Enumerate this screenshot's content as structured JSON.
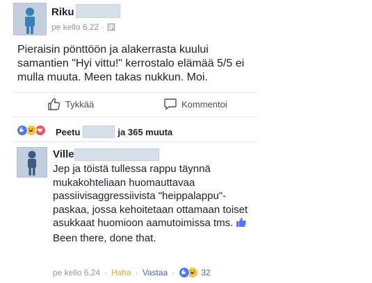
{
  "post": {
    "author": "Riku",
    "time": "pe kello 6.22",
    "separator": "·",
    "text": "Pieraisin pönttöön ja alakerrasta kuului samantien \"Hyi vittu!\" kerrostalo elämää 5/5 ei mulla muuta. Meen takas nukkun. Moi.",
    "privacy_icon": "building-icon"
  },
  "actions": {
    "like_label": "Tykkää",
    "comment_label": "Kommentoi"
  },
  "reactions": {
    "first_name": "Peetu",
    "others": "ja 365 muuta",
    "types": [
      "like",
      "haha",
      "love"
    ],
    "colors": {
      "like": "#4a7bf0",
      "haha": "#f7c43d",
      "love": "#f25268"
    }
  },
  "comment": {
    "author": "Ville",
    "text_before": "Jep ja töistä tullessa rappu täynnä mukakohteliaan huomauttavaa passiivisaggressiivista \"heippalappu\"-paskaa, jossa kehoitetaan ottamaan toiset asukkaat huomioon aamutoimissa tms.",
    "text_after": " Been there, done that.",
    "inline_icon": "thumbs-up-icon",
    "time": "pe kello 6.24",
    "dot1": "·",
    "reaction_label": "Haha",
    "dot2": "·",
    "reply_label": "Vastaa",
    "dot3": "·",
    "reaction_count": "32",
    "reaction_types": [
      "like",
      "haha"
    ]
  }
}
